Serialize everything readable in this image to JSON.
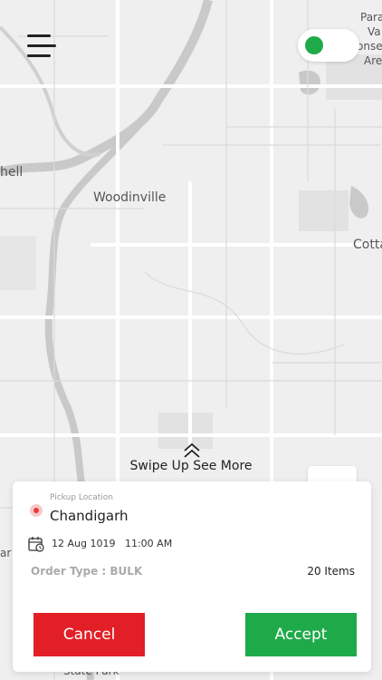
{
  "colors": {
    "toggle_knob": "#1faa4a",
    "cancel_bg": "#e21f26",
    "accept_bg": "#1faa4a",
    "pin": "#e83a3a"
  },
  "map": {
    "labels": [
      {
        "text": "Woodinville"
      },
      {
        "text": "hell"
      },
      {
        "text": "Cotta"
      },
      {
        "text": "Para"
      },
      {
        "text": "Va"
      },
      {
        "text": "onse"
      },
      {
        "text": "Are"
      },
      {
        "text": "State Park"
      },
      {
        "text": "ar"
      }
    ]
  },
  "header": {
    "menu_icon": "hamburger-menu-icon",
    "toggle_on": true
  },
  "swipe": {
    "icon": "chevron-up-double-icon",
    "text": "Swipe Up See More"
  },
  "navigate_icon": "navigation-arrow-icon",
  "order": {
    "pickup_label": "Pickup Location",
    "pickup_value": "Chandigarh",
    "date": "12 Aug 1019",
    "time": "11:00 AM",
    "order_type": "Order Type : BULK",
    "items": "20 Items"
  },
  "actions": {
    "cancel_label": "Cancel",
    "accept_label": "Accept"
  }
}
